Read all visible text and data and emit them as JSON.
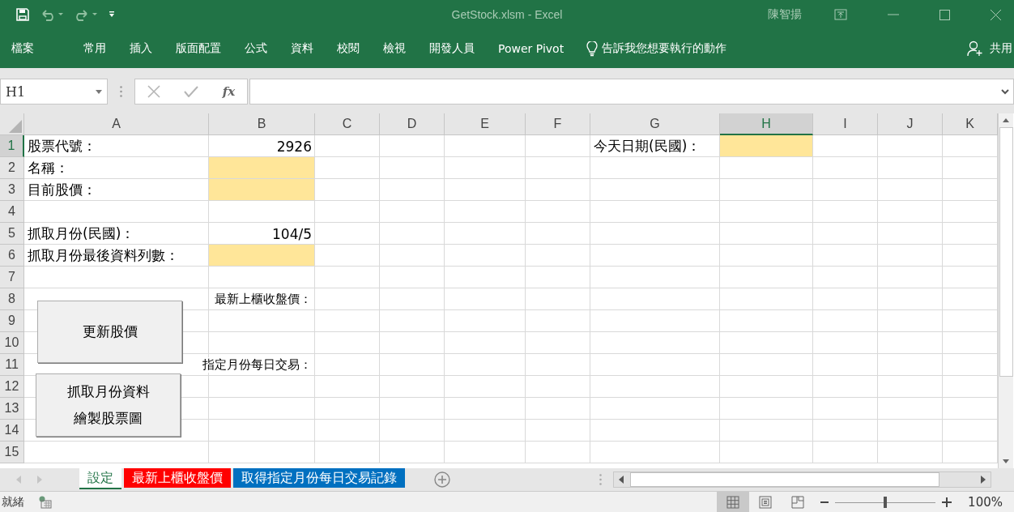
{
  "window": {
    "title": "GetStock.xlsm  -  Excel",
    "user": "陳智揚"
  },
  "ribbon": {
    "tabs": [
      {
        "label": "檔案"
      },
      {
        "label": "常用"
      },
      {
        "label": "插入"
      },
      {
        "label": "版面配置"
      },
      {
        "label": "公式"
      },
      {
        "label": "資料"
      },
      {
        "label": "校閱"
      },
      {
        "label": "檢視"
      },
      {
        "label": "開發人員"
      },
      {
        "label": "Power Pivot"
      }
    ],
    "tell_me": "告訴我您想要執行的動作",
    "share": "共用"
  },
  "formula_bar": {
    "name_box": "H1",
    "fx": "fx"
  },
  "sheet": {
    "columns": [
      {
        "label": "A",
        "selected": false
      },
      {
        "label": "B",
        "selected": false
      },
      {
        "label": "C",
        "selected": false
      },
      {
        "label": "D",
        "selected": false
      },
      {
        "label": "E",
        "selected": false
      },
      {
        "label": "F",
        "selected": false
      },
      {
        "label": "G",
        "selected": false
      },
      {
        "label": "H",
        "selected": true
      },
      {
        "label": "I",
        "selected": false
      },
      {
        "label": "J",
        "selected": false
      },
      {
        "label": "K",
        "selected": false
      }
    ],
    "rows": [
      {
        "label": "1",
        "selected": true,
        "cells": [
          {
            "kind": "text",
            "text": "股票代號："
          },
          {
            "kind": "number",
            "text": "2926"
          },
          {},
          {},
          {},
          {},
          {
            "kind": "text",
            "text": "今天日期(民國)："
          },
          {
            "highlighted": true
          },
          {},
          {},
          {}
        ]
      },
      {
        "label": "2",
        "selected": false,
        "cells": [
          {
            "kind": "text",
            "text": "名稱："
          },
          {
            "highlighted": true
          },
          {},
          {},
          {},
          {},
          {},
          {},
          {},
          {},
          {}
        ]
      },
      {
        "label": "3",
        "selected": false,
        "cells": [
          {
            "kind": "text",
            "text": "目前股價："
          },
          {
            "highlighted": true
          },
          {},
          {},
          {},
          {},
          {},
          {},
          {},
          {},
          {}
        ]
      },
      {
        "label": "4",
        "selected": false,
        "cells": [
          {},
          {},
          {},
          {},
          {},
          {},
          {},
          {},
          {},
          {},
          {}
        ]
      },
      {
        "label": "5",
        "selected": false,
        "cells": [
          {
            "kind": "text",
            "text": "抓取月份(民國)："
          },
          {
            "kind": "number",
            "text": "104/5"
          },
          {},
          {},
          {},
          {},
          {},
          {},
          {},
          {},
          {}
        ]
      },
      {
        "label": "6",
        "selected": false,
        "cells": [
          {
            "kind": "text",
            "text": "抓取月份最後資料列數："
          },
          {
            "highlighted": true
          },
          {},
          {},
          {},
          {},
          {},
          {},
          {},
          {},
          {}
        ]
      },
      {
        "label": "7",
        "selected": false,
        "cells": [
          {},
          {},
          {},
          {},
          {},
          {},
          {},
          {},
          {},
          {},
          {}
        ]
      },
      {
        "label": "8",
        "selected": false,
        "cells": [
          {},
          {
            "kind": "caption",
            "text": "最新上櫃收盤價："
          },
          {},
          {},
          {},
          {},
          {},
          {},
          {},
          {},
          {}
        ]
      },
      {
        "label": "9",
        "selected": false,
        "cells": [
          {},
          {},
          {},
          {},
          {},
          {},
          {},
          {},
          {},
          {},
          {}
        ]
      },
      {
        "label": "10",
        "selected": false,
        "cells": [
          {},
          {},
          {},
          {},
          {},
          {},
          {},
          {},
          {},
          {},
          {}
        ]
      },
      {
        "label": "11",
        "selected": false,
        "cells": [
          {},
          {
            "kind": "caption",
            "text": "指定月份每日交易："
          },
          {},
          {},
          {},
          {},
          {},
          {},
          {},
          {},
          {}
        ]
      },
      {
        "label": "12",
        "selected": false,
        "cells": [
          {},
          {},
          {},
          {},
          {},
          {},
          {},
          {},
          {},
          {},
          {}
        ]
      },
      {
        "label": "13",
        "selected": false,
        "cells": [
          {},
          {},
          {},
          {},
          {},
          {},
          {},
          {},
          {},
          {},
          {}
        ]
      },
      {
        "label": "14",
        "selected": false,
        "cells": [
          {},
          {},
          {},
          {},
          {},
          {},
          {},
          {},
          {},
          {},
          {}
        ]
      },
      {
        "label": "15",
        "selected": false,
        "cells": [
          {},
          {},
          {},
          {},
          {},
          {},
          {},
          {},
          {},
          {},
          {}
        ]
      }
    ],
    "buttons": [
      {
        "lines": [
          "更新股價"
        ]
      },
      {
        "lines": [
          "抓取月份資料",
          "繪製股票圖"
        ]
      }
    ]
  },
  "sheet_tabs": [
    {
      "label": "設定",
      "selected": true
    },
    {
      "label": "最新上櫃收盤價",
      "selected": false,
      "color": "#ff0000"
    },
    {
      "label": "取得指定月份每日交易記錄",
      "selected": false,
      "color": "#0070c0"
    }
  ],
  "status_bar": {
    "status": "就緒",
    "views": [
      {
        "kind": "normal",
        "selected": true
      },
      {
        "kind": "page-layout",
        "selected": false
      },
      {
        "kind": "page-break",
        "selected": false
      }
    ],
    "zoom": {
      "level": 0.5,
      "reading": "100%"
    }
  }
}
